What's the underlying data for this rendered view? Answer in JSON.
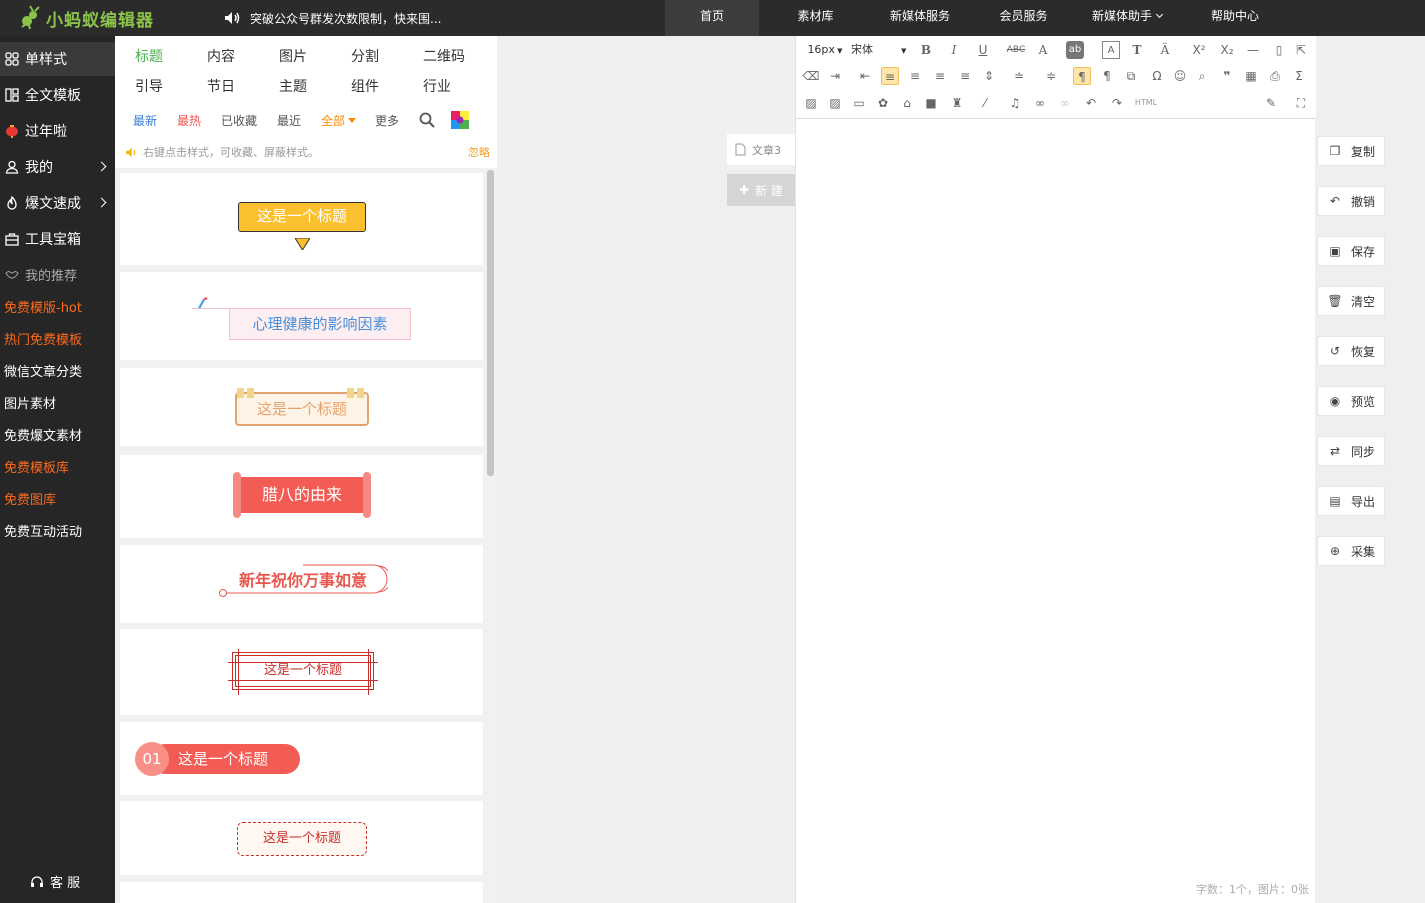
{
  "brand": {
    "name": "小蚂蚁编辑器"
  },
  "notice": {
    "text": "突破公众号群发次数限制，快来围..."
  },
  "nav": [
    {
      "label": "首页",
      "active": true
    },
    {
      "label": "素材库"
    },
    {
      "label": "新媒体服务"
    },
    {
      "label": "会员服务"
    },
    {
      "label": "新媒体助手",
      "dropdown": true
    },
    {
      "label": "帮助中心"
    }
  ],
  "sidebar": {
    "items": [
      {
        "label": "单样式",
        "icon": "grid-icon",
        "active": true
      },
      {
        "label": "全文模板",
        "icon": "layout-icon"
      },
      {
        "label": "过年啦",
        "icon": "lantern-icon"
      },
      {
        "label": "我的",
        "icon": "user-icon",
        "arrow": true
      },
      {
        "label": "爆文速成",
        "icon": "fire-icon",
        "arrow": true
      },
      {
        "label": "工具宝箱",
        "icon": "toolbox-icon"
      }
    ],
    "recommend_label": "我的推荐",
    "links": [
      {
        "label": "免费模版-hot",
        "color": "orange"
      },
      {
        "label": "热门免费模板",
        "color": "orange"
      },
      {
        "label": "微信文章分类",
        "color": "white"
      },
      {
        "label": "图片素材",
        "color": "white"
      },
      {
        "label": "免费爆文素材",
        "color": "white"
      },
      {
        "label": "免费模板库",
        "color": "orange"
      },
      {
        "label": "免费图库",
        "color": "orange"
      },
      {
        "label": "免费互动活动",
        "color": "white"
      }
    ],
    "service_label": "客 服"
  },
  "panel": {
    "categories_row1": [
      "标题",
      "内容",
      "图片",
      "分割",
      "二维码"
    ],
    "categories_row2": [
      "引导",
      "节日",
      "主题",
      "组件",
      "行业"
    ],
    "filters": [
      {
        "label": "最新",
        "color": "blue"
      },
      {
        "label": "最热",
        "color": "red"
      },
      {
        "label": "已收藏"
      },
      {
        "label": "最近"
      },
      {
        "label": "全部",
        "color": "orange",
        "dropdown": true
      },
      {
        "label": "更多"
      }
    ],
    "tip": "右键点击样式，可收藏、屏蔽样式。",
    "ignore": "忽略",
    "templates": [
      {
        "text": "这是一个标题"
      },
      {
        "text": "心理健康的影响因素"
      },
      {
        "text": "这是一个标题"
      },
      {
        "text": "腊八的由来"
      },
      {
        "text": "新年祝你万事如意"
      },
      {
        "text": "这是一个标题"
      },
      {
        "num": "01",
        "text": "这是一个标题"
      },
      {
        "text": "这是一个标题"
      }
    ]
  },
  "docs": {
    "tab": "文章3",
    "new": "新 建"
  },
  "editor": {
    "font_size": "16px",
    "font_family": "宋体",
    "html_label": "HTML",
    "wordcount": "字数：1个，图片：0张"
  },
  "actions": [
    {
      "label": "复制",
      "icon": "copy-icon"
    },
    {
      "label": "撤销",
      "icon": "undo-icon"
    },
    {
      "label": "保存",
      "icon": "save-icon"
    },
    {
      "label": "清空",
      "icon": "trash-icon"
    },
    {
      "label": "恢复",
      "icon": "restore-icon"
    },
    {
      "label": "预览",
      "icon": "eye-icon"
    },
    {
      "label": "同步",
      "icon": "sync-icon"
    },
    {
      "label": "导出",
      "icon": "export-icon"
    },
    {
      "label": "采集",
      "icon": "collect-icon"
    }
  ]
}
